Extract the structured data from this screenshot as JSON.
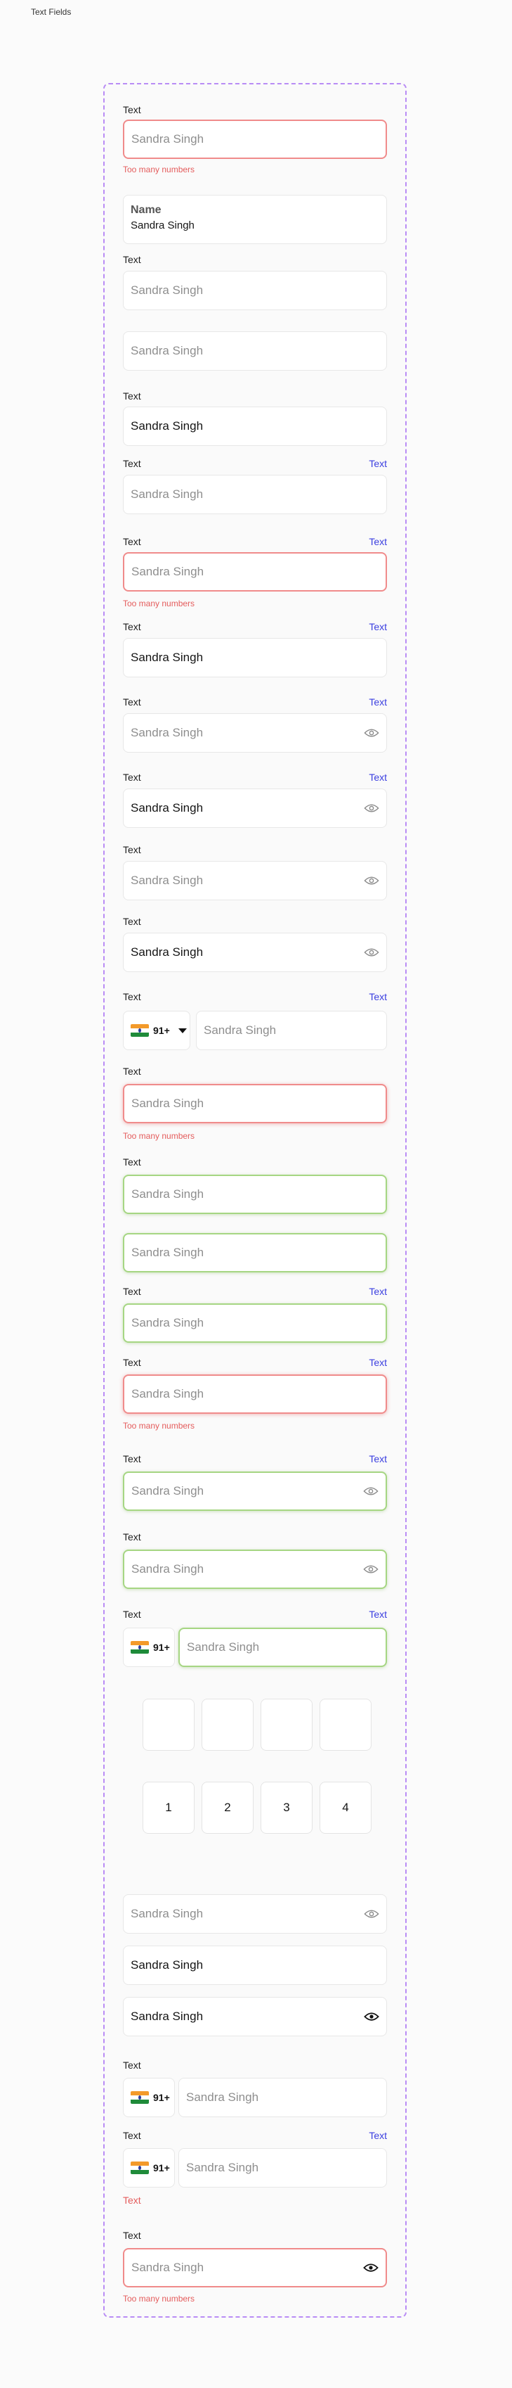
{
  "page": {
    "title": "Text Fields"
  },
  "common": {
    "label": "Text",
    "link": "Text",
    "placeholder": "Sandra Singh",
    "value": "Sandra Singh",
    "error": "Too many numbers",
    "country_code": "91+"
  },
  "named_field": {
    "label": "Name",
    "value": "Sandra Singh"
  },
  "otp": {
    "empty": [
      "",
      "",
      "",
      ""
    ],
    "filled": [
      "1",
      "2",
      "3",
      "4"
    ]
  },
  "error_label": "Text",
  "colors": {
    "error": "#e45c5c",
    "success": "#a6d683",
    "link": "#3b3fe0",
    "frame": "#b98cf5"
  }
}
